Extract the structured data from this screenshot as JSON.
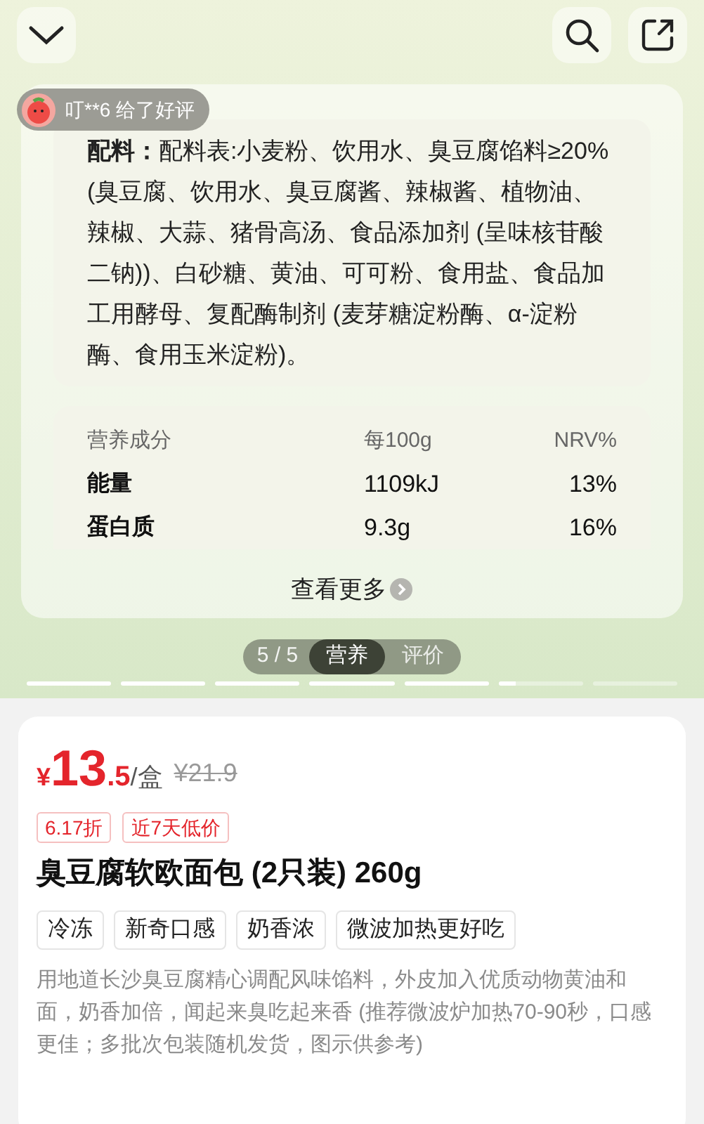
{
  "review_badge": {
    "text": "叮**6 给了好评"
  },
  "ingredients": {
    "text": "**配料：**配料表:小麦粉、饮用水、臭豆腐馅料≥20% (臭豆腐、饮用水、臭豆腐酱、辣椒酱、植物油、辣椒、大蒜、猪骨高汤、食品添加剂 (呈味核苷酸二钠))、白砂糖、黄油、可可粉、食用盐、食品加工用酵母、复配酶制剂 (麦芽糖淀粉酶、α-淀粉酶、食用玉米淀粉)。"
  },
  "nutrition": {
    "columns": [
      "营养成分",
      "每100g",
      "NRV%"
    ],
    "rows": [
      [
        "能量",
        "1109kJ",
        "13%"
      ],
      [
        "蛋白质",
        "9.3g",
        "16%"
      ]
    ]
  },
  "see_more": "查看更多",
  "pager": {
    "count": "5 / 5",
    "tabs": [
      {
        "label": "营养",
        "selected": true
      },
      {
        "label": "评价",
        "selected": false
      }
    ]
  },
  "progress": [
    {
      "level": 1
    },
    {
      "level": 1
    },
    {
      "level": 1
    },
    {
      "level": 1
    },
    {
      "level": 1
    },
    {
      "level": 0.2
    },
    {
      "level": 0
    }
  ],
  "price": {
    "currency": "¥",
    "integer": "13",
    "decimal": ".5",
    "unit": "/盒",
    "original": "¥21.9"
  },
  "promo_tags": [
    "6.17折",
    "近7天低价"
  ],
  "title": "臭豆腐软欧面包 (2只装) 260g",
  "feature_tags": [
    "冷冻",
    "新奇口感",
    "奶香浓",
    "微波加热更好吃"
  ],
  "description": "用地道长沙臭豆腐精心调配风味馅料，外皮加入优质动物黄油和面，奶香加倍，闻起来臭吃起来香 (推荐微波炉加热70-90秒，口感更佳；多批次包装随机发货，图示供参考)"
}
